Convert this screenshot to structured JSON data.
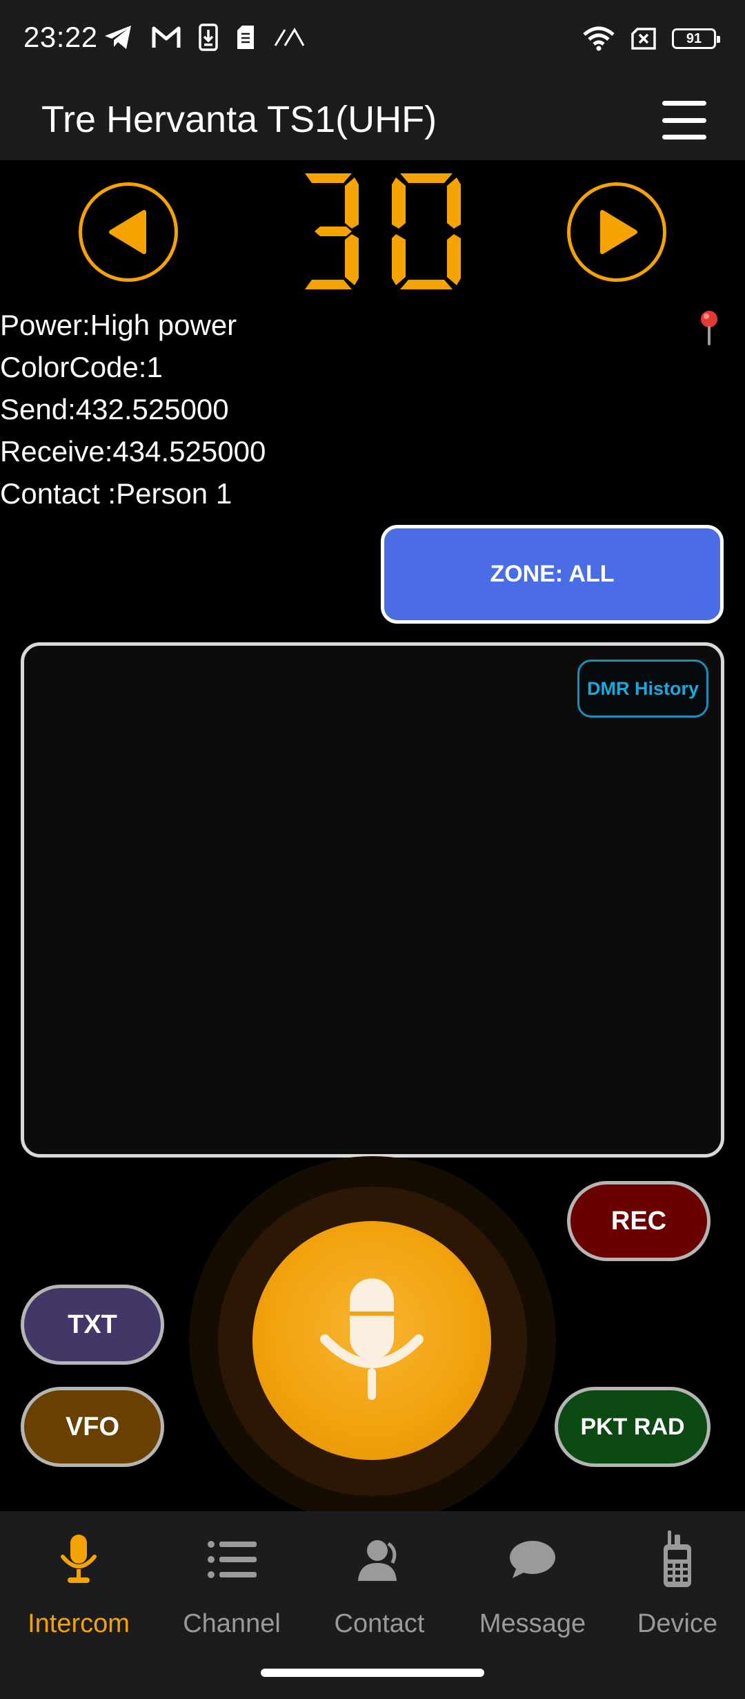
{
  "status_bar": {
    "time": "23:22",
    "battery": "91",
    "left_icons": [
      "telegram-icon",
      "gmail-icon",
      "download-icon",
      "sim-icon",
      "signal-icon"
    ],
    "right_icons": [
      "wifi-icon",
      "no-sim-icon",
      "battery-icon"
    ]
  },
  "header": {
    "title": "Tre Hervanta TS1(UHF)",
    "menu_icon": "hamburger-menu-icon"
  },
  "channel": {
    "number": "30",
    "prev_icon": "previous-channel-icon",
    "next_icon": "next-channel-icon"
  },
  "info": {
    "power": "Power:High power",
    "color_code": "ColorCode:1",
    "send": "Send:432.525000",
    "receive": "Receive:434.525000",
    "contact": "Contact :Person 1",
    "location_icon": "location-pin-icon"
  },
  "zone_button": "ZONE: ALL",
  "dmr_history_button": "DMR History",
  "buttons": {
    "rec": "REC",
    "txt": "TXT",
    "vfo": "VFO",
    "pkt_rad": "PKT RAD",
    "ptt_icon": "microphone-icon"
  },
  "bottom_nav": [
    {
      "label": "Intercom",
      "icon": "microphone-icon",
      "active": true
    },
    {
      "label": "Channel",
      "icon": "list-icon",
      "active": false
    },
    {
      "label": "Contact",
      "icon": "person-icon",
      "active": false
    },
    {
      "label": "Message",
      "icon": "chat-bubble-icon",
      "active": false
    },
    {
      "label": "Device",
      "icon": "radio-device-icon",
      "active": false
    }
  ],
  "colors": {
    "accent": "#f5a300",
    "zone_blue": "#4a6de6",
    "rec_red": "#6b0000",
    "txt_purple": "#433768",
    "vfo_brown": "#6a4000",
    "pkt_green": "#0b4a12",
    "history_cyan": "#1ca7dd"
  }
}
